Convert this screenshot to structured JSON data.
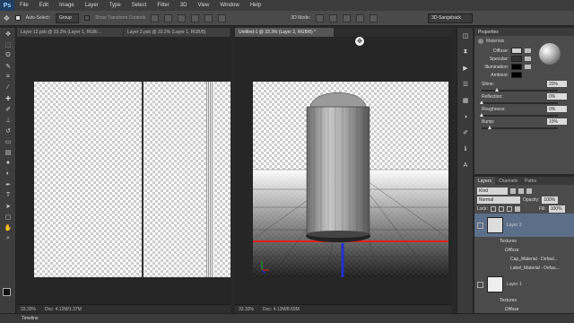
{
  "menubar": {
    "app_logo": "Ps",
    "items": [
      "File",
      "Edit",
      "Image",
      "Layer",
      "Type",
      "Select",
      "Filter",
      "3D",
      "View",
      "Window",
      "Help"
    ]
  },
  "options": {
    "auto_select_label": "Auto-Select:",
    "auto_select_value": "Group",
    "show_transform": "Show Transform Controls",
    "mode_3d": "3D Mode:",
    "workspace": "3D-Sangsback"
  },
  "docs": {
    "left_tabs": [
      "Layer 12.psb @ 33.3% (Layer 1, RGB/...",
      "Layer 2.psb @ 33.3% (Layer 1, RGB/8)"
    ],
    "right_tab": "Untitled-1 @ 33.3% (Layer 2, RGB/8) *",
    "left_zoom": "33.33%",
    "left_doc": "Doc: 4.12M/1.37M",
    "right_zoom": "33.33%",
    "right_doc": "Doc: 4.12M/8.69M"
  },
  "properties": {
    "title": "Properties",
    "section": "Materials",
    "diffuse": "Diffuse:",
    "specular": "Specular:",
    "illumination": "Illumination:",
    "ambient": "Ambient:",
    "shine_label": "Shine:",
    "shine_val": "20%",
    "shine_level": 0.2,
    "reflection_label": "Reflection:",
    "reflection_val": "0%",
    "reflection_level": 0,
    "roughness_label": "Roughness:",
    "roughness_val": "0%",
    "roughness_level": 0,
    "bump_label": "Bump:",
    "bump_val": "10%",
    "bump_level": 0.1
  },
  "layers": {
    "tabs": [
      "Layers",
      "Channels",
      "Paths"
    ],
    "kind": "Kind",
    "blend": "Normal",
    "opacity_label": "Opacity:",
    "opacity_val": "100%",
    "lock_label": "Lock:",
    "fill_label": "Fill:",
    "fill_val": "100%",
    "layer2": "Layer 2",
    "textures": "Textures",
    "diffuse": "Diffuse",
    "tex1": "Cap_Material - Defaul...",
    "tex2": "Label_Material - Defau...",
    "layer1": "Layer 1",
    "textures2": "Textures",
    "diffuse2": "Diffuse"
  },
  "timeline": "Timeline",
  "colors": {
    "accent_red": "#e0201a",
    "accent_blue": "#2030d0",
    "ui_bg": "#282828"
  }
}
